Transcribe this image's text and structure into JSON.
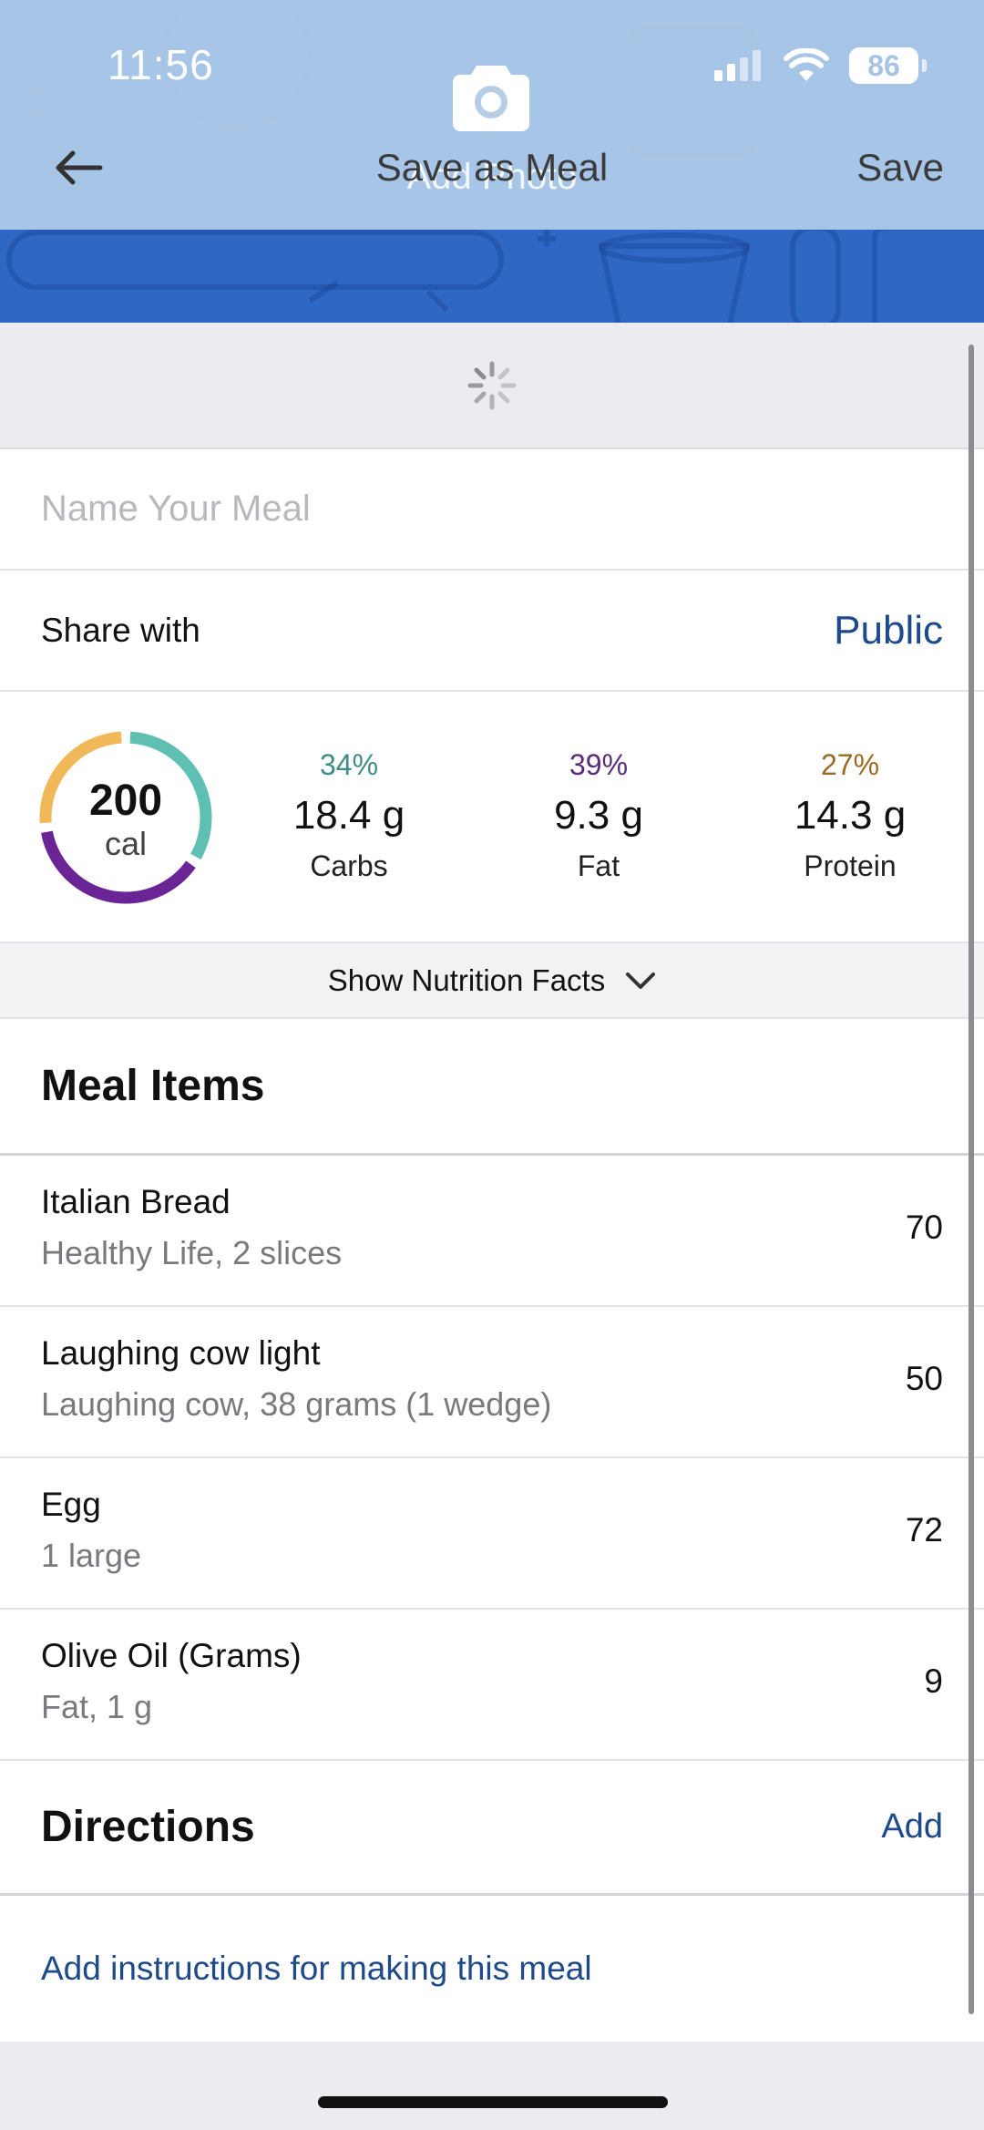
{
  "status_bar": {
    "time": "11:56",
    "battery": "86"
  },
  "header": {
    "add_photo_label": "Add Photo",
    "title": "Save as Meal",
    "save_label": "Save",
    "back_icon": "arrow-left-icon",
    "camera_icon": "camera-icon"
  },
  "meal_name": {
    "placeholder": "Name Your Meal",
    "value": ""
  },
  "share": {
    "label": "Share with",
    "value": "Public"
  },
  "summary": {
    "calories": "200",
    "calories_unit": "cal",
    "macros": [
      {
        "pct": "34%",
        "grams": "18.4 g",
        "name": "Carbs",
        "color": "#3f8c87"
      },
      {
        "pct": "39%",
        "grams": "9.3 g",
        "name": "Fat",
        "color": "#5b2c7a"
      },
      {
        "pct": "27%",
        "grams": "14.3 g",
        "name": "Protein",
        "color": "#9a6b23"
      }
    ],
    "ring_colors": {
      "carbs": "#5fbfb3",
      "fat": "#6a2495",
      "protein": "#f0b858"
    },
    "ring_fractions": {
      "carbs": 0.34,
      "fat": 0.39,
      "protein": 0.27
    }
  },
  "nutrition_toggle": {
    "label": "Show Nutrition Facts"
  },
  "meal_items": {
    "title": "Meal Items",
    "items": [
      {
        "name": "Italian Bread",
        "detail": "Healthy Life, 2 slices",
        "calories": "70"
      },
      {
        "name": "Laughing cow light",
        "detail": "Laughing cow, 38 grams (1 wedge)",
        "calories": "50"
      },
      {
        "name": "Egg",
        "detail": "1 large",
        "calories": "72"
      },
      {
        "name": "Olive Oil (Grams)",
        "detail": "Fat, 1 g",
        "calories": "9"
      }
    ]
  },
  "directions": {
    "title": "Directions",
    "add_label": "Add",
    "instructions_link": "Add instructions for making this meal"
  },
  "colors": {
    "accent_link": "#1e4a8c",
    "header_blue": "#2f68c4"
  }
}
